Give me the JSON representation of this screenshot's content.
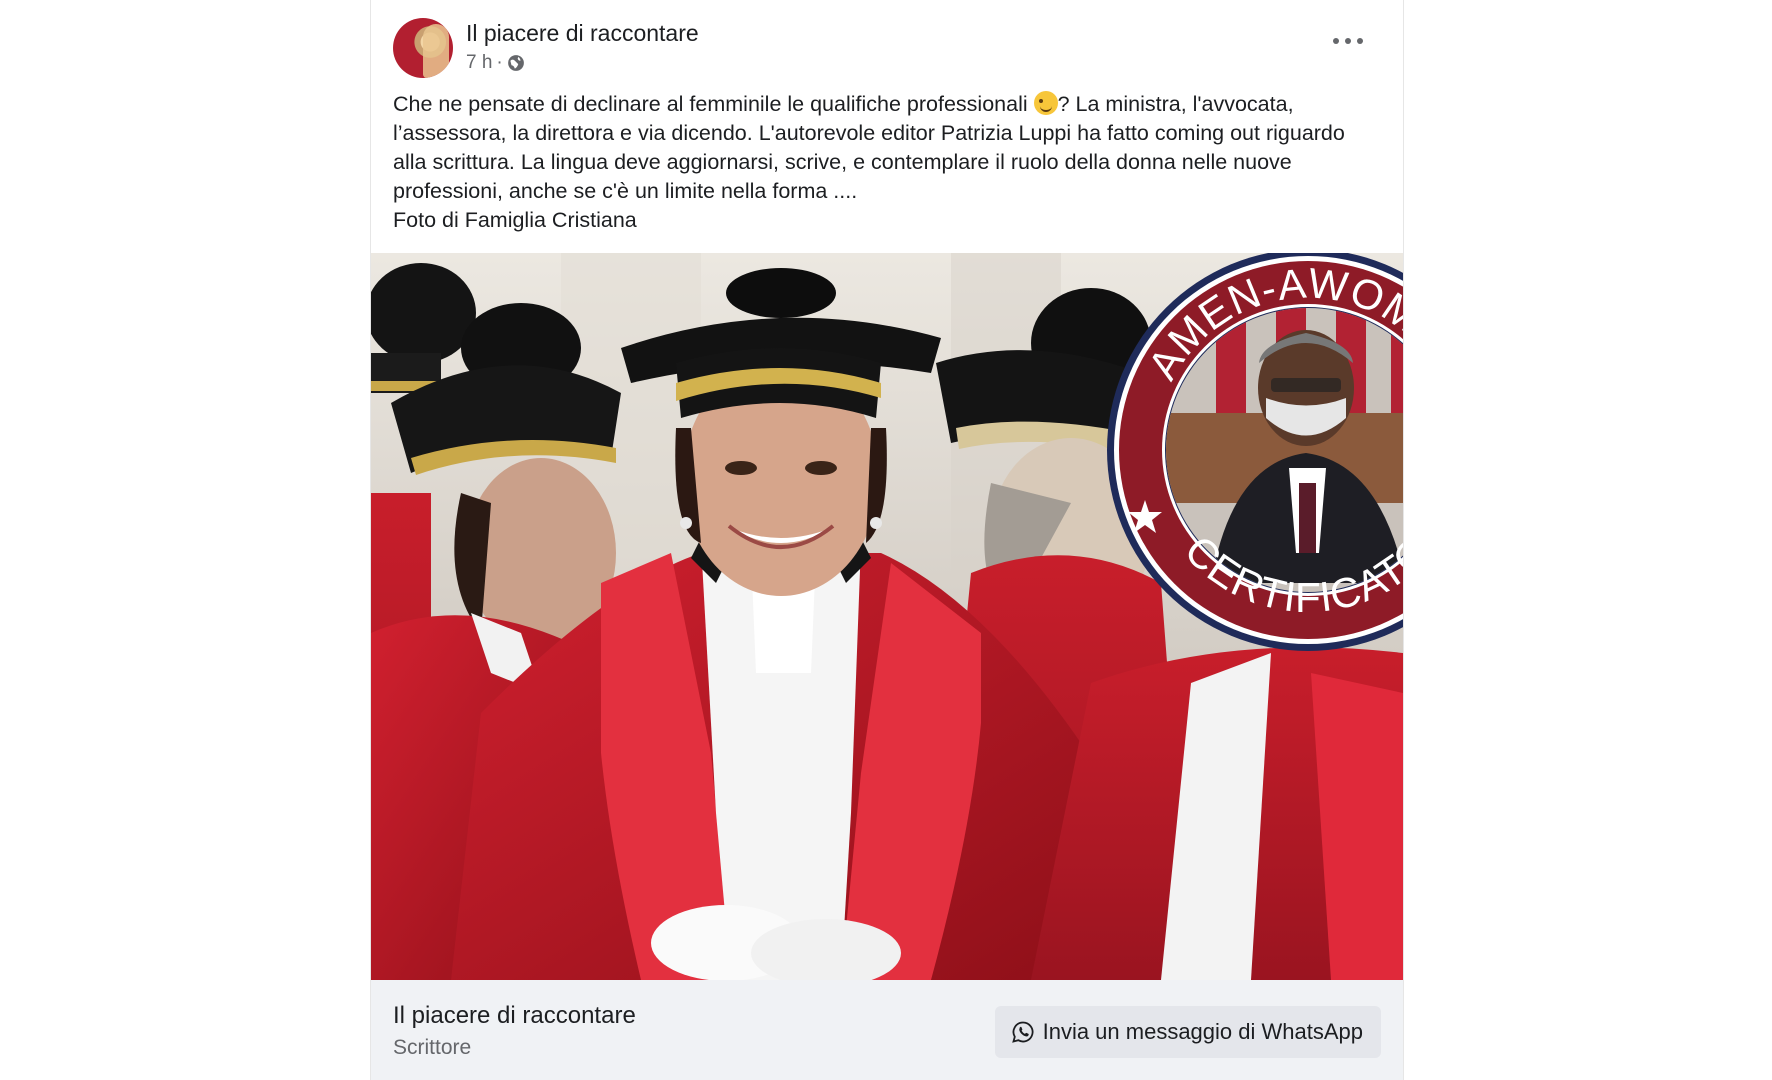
{
  "post": {
    "page_name": "Il piacere di raccontare",
    "time": "7 h",
    "separator": "·",
    "privacy_icon": "globe-icon",
    "menu_icon": "more-horizontal-icon",
    "body_lines": [
      "Che ne pensate di declinare al femminile le qualifiche professionali",
      "? La ministra, l'avvocata, l’assessora, la direttora e via dicendo. L'autorevole editor Patrizia Luppi ha fatto coming out riguardo alla scrittura. La lingua deve aggiornarsi, scrive, e contemplare il ruolo della donna nelle nuove professioni, anche se c'è un limite nella forma ....",
      "Foto di Famiglia Cristiana"
    ],
    "emoji": "winking-face-emoji"
  },
  "badge": {
    "top_text": "AMEN-AWOMEN",
    "bottom_text": "CERTIFICATO",
    "ring_color": "#8e1b27",
    "border_color": "#23305f"
  },
  "footer": {
    "page_name": "Il piacere di raccontare",
    "category": "Scrittore",
    "cta_label": "Invia un messaggio di WhatsApp",
    "cta_icon": "whatsapp-icon"
  }
}
